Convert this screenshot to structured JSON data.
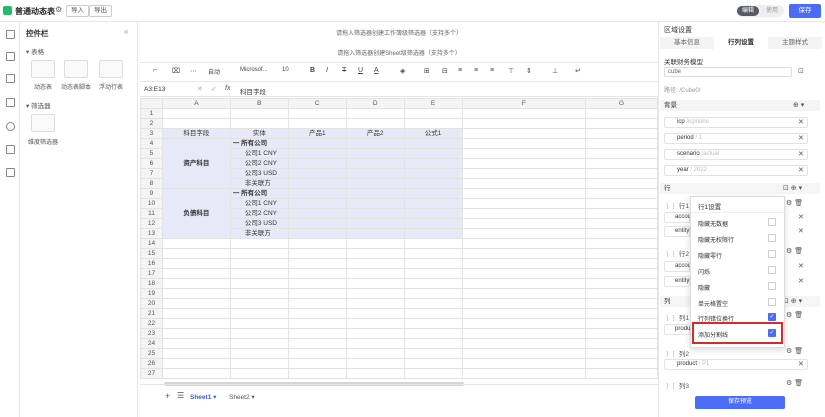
{
  "topbar": {
    "title": "普通动态表",
    "import": "导入",
    "export": "导出",
    "mode_edit": "编辑",
    "mode_use": "使用",
    "save": "保存"
  },
  "panel": {
    "title": "控件栏",
    "sec_table": "表格",
    "items": [
      "动态表",
      "动态表脚本",
      "浮动行表"
    ],
    "sec_filter": "筛选器",
    "filter_item": "维度筛选器"
  },
  "sheet": {
    "hint1": "请拖入筛选器创建工作簿级筛选器（支持多个）",
    "hint2": "请拖入筛选器创建Sheet级筛选器（支持多个）",
    "font": "Microsof...",
    "font_size": "10",
    "auto": "自动",
    "cell_ref": "A3:E13",
    "formula": "科目字段",
    "cols": [
      "A",
      "B",
      "C",
      "D",
      "E",
      "F",
      "G"
    ],
    "header_row": [
      "科目字段",
      "实体",
      "产品1",
      "产品2",
      "公式1"
    ],
    "group1": "资产科目",
    "group2": "负债科目",
    "entities": [
      "一 所有公司",
      "公司1 CNY",
      "公司2 CNY",
      "公司3 USD",
      "非关联方"
    ],
    "tabs": [
      "Sheet1",
      "Sheet2"
    ]
  },
  "right": {
    "title": "区域设置",
    "tabs": [
      "基本信息",
      "行列设置",
      "主题样式"
    ],
    "model_label": "关联财务模型",
    "model_value": "cube",
    "path_label": "路径:",
    "path_value": "/Cube0/",
    "bg_label": "背景",
    "bg_items": [
      {
        "k": "icp",
        "v": "/icpnone"
      },
      {
        "k": "period",
        "v": "/ 1"
      },
      {
        "k": "scenario",
        "v": "/actual"
      },
      {
        "k": "year",
        "v": "/ 2022"
      }
    ],
    "row_label": "行",
    "row1": "行1",
    "row1_a": "accou",
    "row1_b": "entity",
    "row2": "行2",
    "row2_a": "accou",
    "row2_b": "entity",
    "col_label": "列",
    "col1": "列1",
    "col1_a": "produ",
    "col2": "列2",
    "col2_a": "product",
    "col2_a_v": "/ P1",
    "col3": "列3",
    "preview": "保存预览"
  },
  "popup": {
    "title": "行1设置",
    "items": [
      "隐藏无数据",
      "隐藏无权限行",
      "隐藏零行",
      "闪烁",
      "隐藏",
      "单元格置空",
      "行列错位换行",
      "添加分割线"
    ],
    "checked": [
      false,
      false,
      false,
      false,
      false,
      false,
      true,
      true
    ]
  },
  "colors": {
    "accent": "#4a6cf7",
    "highlight": "#d62b2b",
    "sel": "#e7e9f8"
  }
}
